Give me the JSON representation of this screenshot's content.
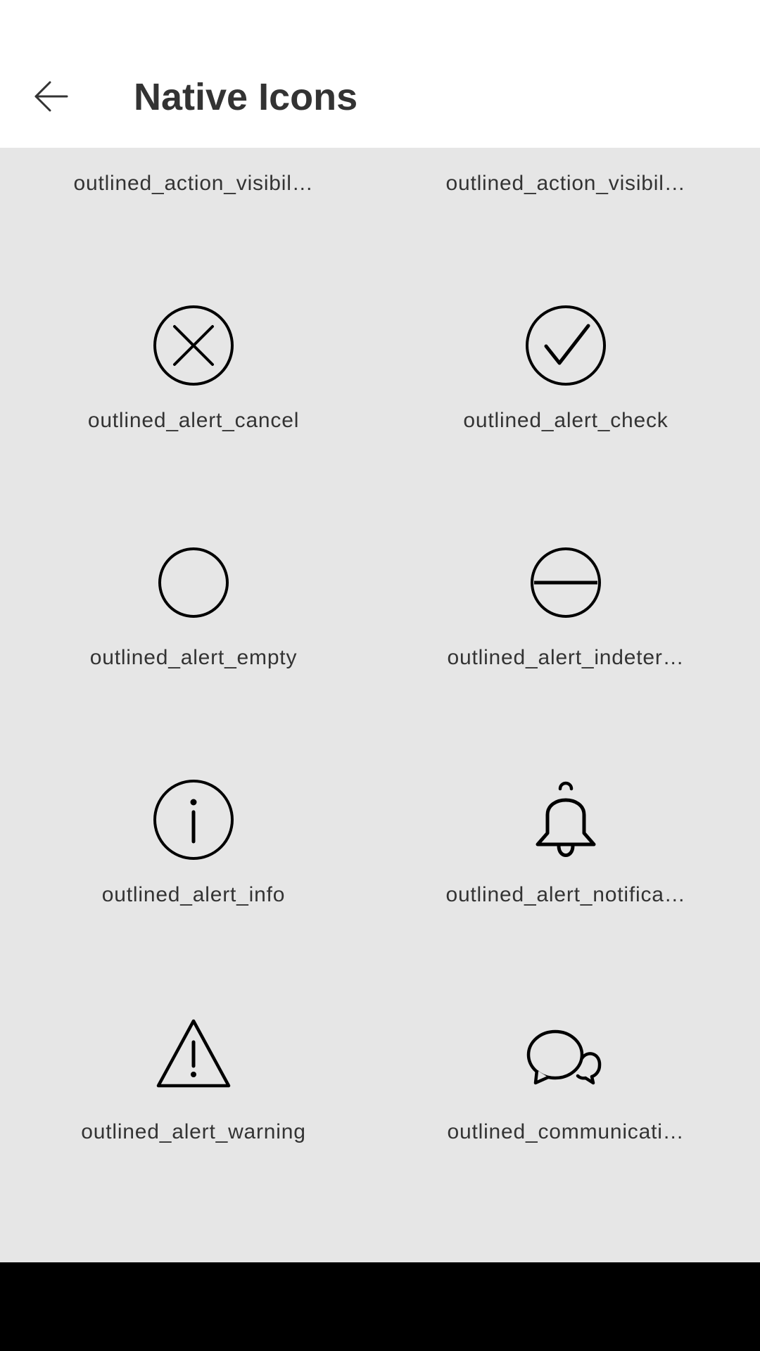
{
  "header": {
    "title": "Native Icons"
  },
  "icons": [
    {
      "label": "outlined_action_visibil…",
      "icon": "visibility-icon"
    },
    {
      "label": "outlined_action_visibil…",
      "icon": "visibility-off-icon"
    },
    {
      "label": "outlined_alert_cancel",
      "icon": "cancel-circle-icon"
    },
    {
      "label": "outlined_alert_check",
      "icon": "check-circle-icon"
    },
    {
      "label": "outlined_alert_empty",
      "icon": "empty-circle-icon"
    },
    {
      "label": "outlined_alert_indeter…",
      "icon": "indeterminate-circle-icon"
    },
    {
      "label": "outlined_alert_info",
      "icon": "info-circle-icon"
    },
    {
      "label": "outlined_alert_notifica…",
      "icon": "bell-icon"
    },
    {
      "label": "outlined_alert_warning",
      "icon": "warning-triangle-icon"
    },
    {
      "label": "outlined_communicati…",
      "icon": "chat-bubbles-icon"
    }
  ],
  "colors": {
    "app_bar": "#ffffff",
    "content_bg": "#e6e6e6",
    "text": "#333333",
    "icon_stroke": "#000000",
    "nav_bar": "#000000"
  }
}
